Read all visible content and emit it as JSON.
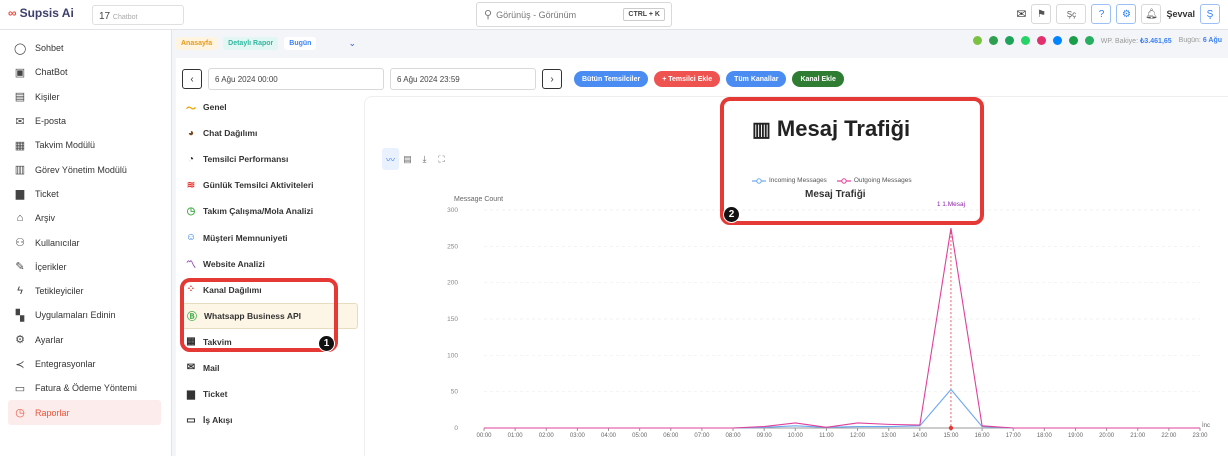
{
  "app": {
    "logo": "Supsis Ai",
    "chatbot_count": "17",
    "chatbot_label": "Chatbot"
  },
  "search": {
    "placeholder": "Görünüş - Görünüm",
    "shortcut": "CTRL + K"
  },
  "topbar": {
    "user_name": "Şevval",
    "user_initial": "Ş",
    "lang": "Şç",
    "lang_sub": "6"
  },
  "sidebar": {
    "items": [
      {
        "label": "Sohbet",
        "icon": "chat-icon"
      },
      {
        "label": "ChatBot",
        "icon": "bot-icon"
      },
      {
        "label": "Kişiler",
        "icon": "contacts-icon"
      },
      {
        "label": "E-posta",
        "icon": "mail-icon"
      },
      {
        "label": "Takvim Modülü",
        "icon": "calendar-icon"
      },
      {
        "label": "Görev Yönetim Modülü",
        "icon": "task-icon"
      },
      {
        "label": "Ticket",
        "icon": "ticket-icon"
      },
      {
        "label": "Arşiv",
        "icon": "archive-icon"
      },
      {
        "label": "Kullanıcılar",
        "icon": "users-icon"
      },
      {
        "label": "İçerikler",
        "icon": "content-icon"
      },
      {
        "label": "Tetikleyiciler",
        "icon": "trigger-icon"
      },
      {
        "label": "Uygulamaları Edinin",
        "icon": "apps-icon"
      },
      {
        "label": "Ayarlar",
        "icon": "settings-icon"
      },
      {
        "label": "Entegrasyonlar",
        "icon": "integrations-icon"
      },
      {
        "label": "Fatura & Ödeme Yöntemi",
        "icon": "billing-icon"
      },
      {
        "label": "Raporlar",
        "icon": "reports-icon",
        "active": true
      }
    ]
  },
  "breadcrumb": {
    "home": "Anasayfa",
    "detail": "Detaylı Rapor",
    "period": "Bugün"
  },
  "status": {
    "balance_label": "WP. Bakiye:",
    "balance_value": "₺3.461,65",
    "date_label": "Bugün:",
    "date_value": "6 Ağu"
  },
  "datebar": {
    "start": "6 Ağu 2024 00:00",
    "end": "6 Ağu 2024 23:59",
    "btn_all_reps": "Bütün Temsilciler",
    "btn_add_rep": "+ Temsilci Ekle",
    "btn_all_channels": "Tüm Kanallar",
    "btn_add_channel": "Kanal Ekle"
  },
  "menu": {
    "items": [
      {
        "label": "Genel",
        "icon": "trend-icon"
      },
      {
        "label": "Chat Dağılımı",
        "icon": "pie-icon"
      },
      {
        "label": "Temsilci Performansı",
        "icon": "gauge-icon"
      },
      {
        "label": "Günlük Temsilci Aktiviteleri",
        "icon": "wifi-icon"
      },
      {
        "label": "Takım Çalışma/Mola Analizi",
        "icon": "clock-icon"
      },
      {
        "label": "Müşteri Memnuniyeti",
        "icon": "smile-icon"
      },
      {
        "label": "Website Analizi",
        "icon": "analytics-icon"
      },
      {
        "label": "Kanal Dağılımı",
        "icon": "channels-icon"
      },
      {
        "label": "Whatsapp Business API",
        "icon": "whatsapp-icon",
        "selected": true
      },
      {
        "label": "Takvim",
        "icon": "calendar-icon"
      },
      {
        "label": "Mail",
        "icon": "mail-icon"
      },
      {
        "label": "Ticket",
        "icon": "ticket-icon"
      },
      {
        "label": "İş Akışı",
        "icon": "workflow-icon"
      }
    ]
  },
  "panel": {
    "heading": "Mesaj Trafiği"
  },
  "annotations": {
    "badge1": "1",
    "badge2": "2"
  },
  "colors": {
    "accent": "#3b82f6",
    "danger": "#e53935",
    "incoming": "#6aa9f0",
    "outgoing": "#e0409a"
  },
  "chart_data": {
    "type": "line",
    "title": "Mesaj Trafiği",
    "ylabel": "Message Count",
    "ylim": [
      0,
      300
    ],
    "yticks": [
      0,
      50,
      100,
      150,
      200,
      250,
      300
    ],
    "x": [
      "00:00",
      "01:00",
      "02:00",
      "03:00",
      "04:00",
      "05:00",
      "06:00",
      "07:00",
      "08:00",
      "09:00",
      "10:00",
      "11:00",
      "12:00",
      "13:00",
      "14:00",
      "15:00",
      "16:00",
      "17:00",
      "18:00",
      "19:00",
      "20:00",
      "21:00",
      "22:00",
      "23:00"
    ],
    "series": [
      {
        "name": "Incoming Messages",
        "color": "#6aa9f0",
        "values": [
          0,
          0,
          0,
          0,
          0,
          0,
          0,
          0,
          0,
          1,
          3,
          1,
          2,
          2,
          3,
          53,
          2,
          0,
          0,
          0,
          0,
          0,
          0,
          0
        ]
      },
      {
        "name": "Outgoing Messages",
        "color": "#e0409a",
        "values": [
          0,
          0,
          0,
          0,
          0,
          0,
          0,
          0,
          0,
          2,
          7,
          1,
          7,
          5,
          4,
          275,
          3,
          0,
          0,
          0,
          0,
          0,
          0,
          0
        ]
      }
    ],
    "markline": {
      "x": "15:00",
      "label": "1 1.Mesaj"
    },
    "xaxis_end_label": "İnc"
  }
}
